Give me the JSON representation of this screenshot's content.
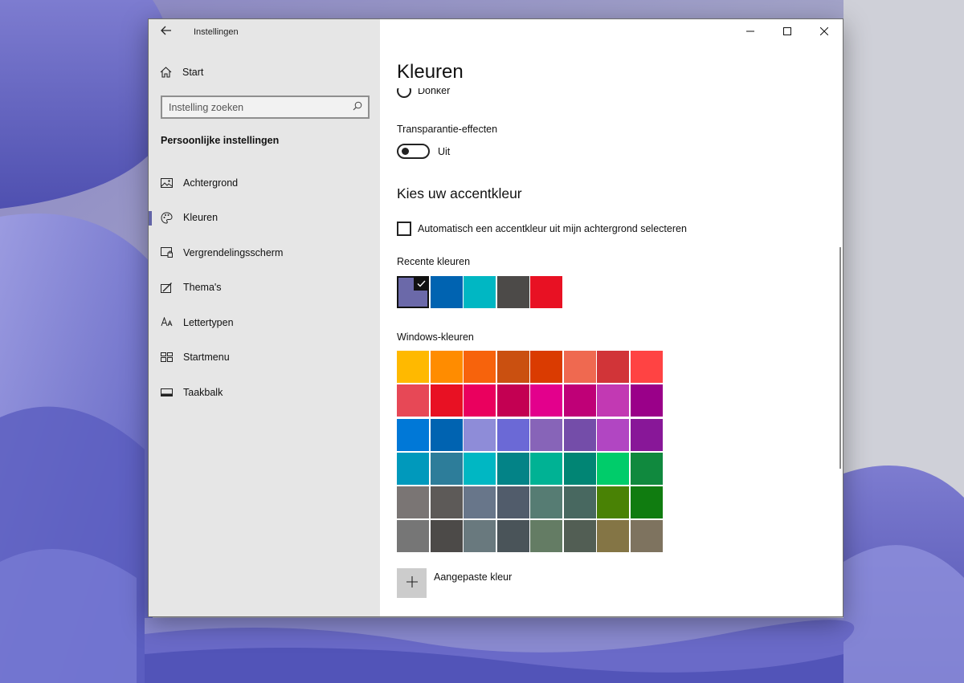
{
  "window": {
    "app_title": "Instellingen",
    "back_icon": "arrow-left-icon",
    "controls": [
      "minimize-icon",
      "maximize-icon",
      "close-icon"
    ]
  },
  "sidebar": {
    "home_label": "Start",
    "search_placeholder": "Instelling zoeken",
    "section_title": "Persoonlijke instellingen",
    "items": [
      {
        "label": "Achtergrond",
        "icon": "picture-icon",
        "active": false
      },
      {
        "label": "Kleuren",
        "icon": "palette-icon",
        "active": true
      },
      {
        "label": "Vergrendelingsscherm",
        "icon": "lock-screen-icon",
        "active": false
      },
      {
        "label": "Thema's",
        "icon": "theme-brush-icon",
        "active": false
      },
      {
        "label": "Lettertypen",
        "icon": "font-icon",
        "active": false
      },
      {
        "label": "Startmenu",
        "icon": "start-menu-icon",
        "active": false
      },
      {
        "label": "Taakbalk",
        "icon": "taskbar-icon",
        "active": false
      }
    ]
  },
  "main": {
    "page_title": "Kleuren",
    "radio_label": "Donker",
    "transparency_label": "Transparantie-effecten",
    "toggle_state": "Uit",
    "accent_heading": "Kies uw accentkleur",
    "auto_accent_label": "Automatisch een accentkleur uit mijn achtergrond selecteren",
    "recent_label": "Recente kleuren",
    "recent_colors": [
      "#6b69a9",
      "#0063b1",
      "#00b7c3",
      "#4c4a48",
      "#e81123"
    ],
    "selected_recent_index": 0,
    "windows_colors_label": "Windows-kleuren",
    "windows_colors": [
      "#ffb900",
      "#ff8c00",
      "#f7630c",
      "#ca5010",
      "#da3b01",
      "#ef6950",
      "#d13438",
      "#ff4343",
      "#e74856",
      "#e81123",
      "#ea005e",
      "#c30052",
      "#e3008c",
      "#bf0077",
      "#c239b3",
      "#9a0089",
      "#0078d7",
      "#0063b1",
      "#8e8cd8",
      "#6b69d6",
      "#8764b8",
      "#744da9",
      "#b146c2",
      "#881798",
      "#0099bc",
      "#2d7d9a",
      "#00b7c3",
      "#038387",
      "#00b294",
      "#018574",
      "#00cc6a",
      "#10893e",
      "#7a7574",
      "#5d5a58",
      "#68768a",
      "#515c6b",
      "#567c73",
      "#486860",
      "#498205",
      "#107c10",
      "#767676",
      "#4c4a48",
      "#69797e",
      "#4a5459",
      "#647c64",
      "#525e54",
      "#847545",
      "#7e735f"
    ],
    "custom_color_label": "Aangepaste kleur",
    "custom_color_icon": "plus-icon"
  }
}
